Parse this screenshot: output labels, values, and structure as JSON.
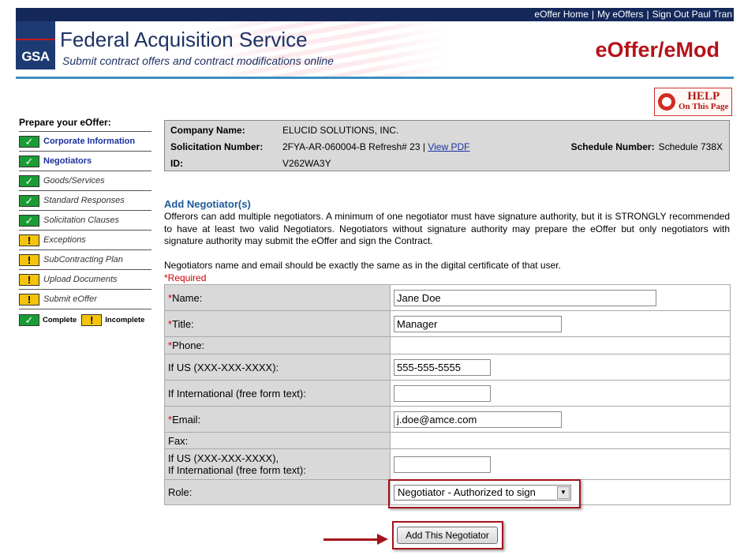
{
  "top_nav": {
    "home": "eOffer Home",
    "my_eoffers": "My eOffers",
    "sign_out": "Sign Out Paul Tran"
  },
  "header": {
    "logo": "GSA",
    "agency": "Federal Acquisition Service",
    "tagline": "Submit contract offers and contract modifications online",
    "app_name": "eOffer/eMod"
  },
  "help": {
    "line1": "HELP",
    "line2": "On This Page"
  },
  "sidebar": {
    "title": "Prepare your eOffer:",
    "items": [
      {
        "label": "Corporate Information",
        "status": "complete",
        "style": "link"
      },
      {
        "label": "Negotiators",
        "status": "complete",
        "style": "link"
      },
      {
        "label": "Goods/Services",
        "status": "complete",
        "style": "italic"
      },
      {
        "label": "Standard Responses",
        "status": "complete",
        "style": "italic"
      },
      {
        "label": "Solicitation Clauses",
        "status": "complete",
        "style": "italic"
      },
      {
        "label": "Exceptions",
        "status": "incomplete",
        "style": "italic"
      },
      {
        "label": "SubContracting Plan",
        "status": "incomplete",
        "style": "italic"
      },
      {
        "label": "Upload Documents",
        "status": "incomplete",
        "style": "italic"
      },
      {
        "label": "Submit eOffer",
        "status": "incomplete",
        "style": "italic"
      }
    ],
    "legend": {
      "complete": "Complete",
      "incomplete": "Incomplete"
    }
  },
  "info": {
    "company_label": "Company Name:",
    "company_value": "ELUCID SOLUTIONS, INC.",
    "solicitation_label": "Solicitation Number:",
    "solicitation_value": "2FYA-AR-060004-B Refresh# 23 |",
    "view_pdf": "View PDF",
    "schedule_label": "Schedule Number:",
    "schedule_value": "Schedule 738X",
    "id_label": "ID:",
    "id_value": "V262WA3Y"
  },
  "section": {
    "title": "Add Negotiator(s)",
    "description": "Offerors can add multiple negotiators. A minimum of one negotiator must have signature authority, but it is STRONGLY recommended to have at least two valid Negotiators. Negotiators without signature authority may prepare the eOffer but only negotiators with signature authority may submit the eOffer and sign the Contract.",
    "note": "Negotiators name and email should be exactly the same as in the digital certificate of that user.",
    "required": "*Required"
  },
  "form": {
    "name_label": "Name:",
    "name_value": "Jane Doe",
    "title_label": "Title:",
    "title_value": "Manager",
    "phone_label": "Phone:",
    "phone_us_label": "If US (XXX-XXX-XXXX):",
    "phone_us_value": "555-555-5555",
    "phone_intl_label": "If International (free form text):",
    "phone_intl_value": "",
    "email_label": "Email:",
    "email_value": "j.doe@amce.com",
    "fax_label": "Fax:",
    "fax_line1": "If US (XXX-XXX-XXXX),",
    "fax_line2": "If International (free form text):",
    "fax_value": "",
    "role_label": "Role:",
    "role_value": "Negotiator - Authorized to sign",
    "required_mark": "*"
  },
  "actions": {
    "add_button": "Add This Negotiator"
  },
  "colors": {
    "navy": "#14285a",
    "brand_red": "#b5121b",
    "section_blue": "#1d5a9b",
    "complete_green": "#1a9c34",
    "incomplete_yellow": "#f4c40c"
  }
}
